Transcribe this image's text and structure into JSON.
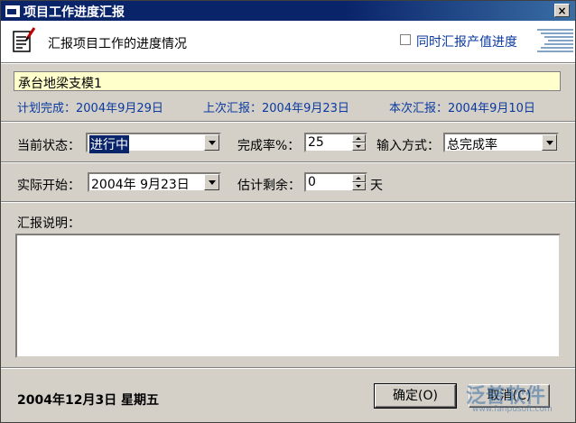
{
  "window": {
    "title": "项目工作进度汇报",
    "close_label": "×"
  },
  "header": {
    "title": "汇报项目工作的进度情况",
    "checkbox_label": "同时汇报产值进度",
    "checkbox_checked": false
  },
  "task": {
    "name": "承台地梁支模1"
  },
  "plan": {
    "planned_finish": "计划完成：2004年9月29日",
    "last_report": "上次汇报：2004年9月23日",
    "this_report": "本次汇报：2004年9月10日"
  },
  "status": {
    "state_label": "当前状态：",
    "state_value": "进行中",
    "completion_label": "完成率%：",
    "completion_value": "25",
    "input_mode_label": "输入方式：",
    "input_mode_value": "总完成率"
  },
  "schedule": {
    "actual_start_label": "实际开始：",
    "actual_start_value": "2004年  9月23日",
    "remaining_label": "估计剩余：",
    "remaining_value": "0",
    "remaining_unit": "天"
  },
  "report": {
    "label": "汇报说明：",
    "text": ""
  },
  "footer": {
    "date": "2004年12月3日  星期五",
    "ok_label": "确定(O)",
    "cancel_label": "取消(C)"
  },
  "watermark": {
    "text": "泛普软件",
    "url": "www.fanpusoft.com"
  },
  "colors": {
    "title_bar": "#0a246a",
    "accent_text": "#0a3aa0",
    "task_bg": "#ffffcc",
    "face": "#d4d0c8"
  }
}
